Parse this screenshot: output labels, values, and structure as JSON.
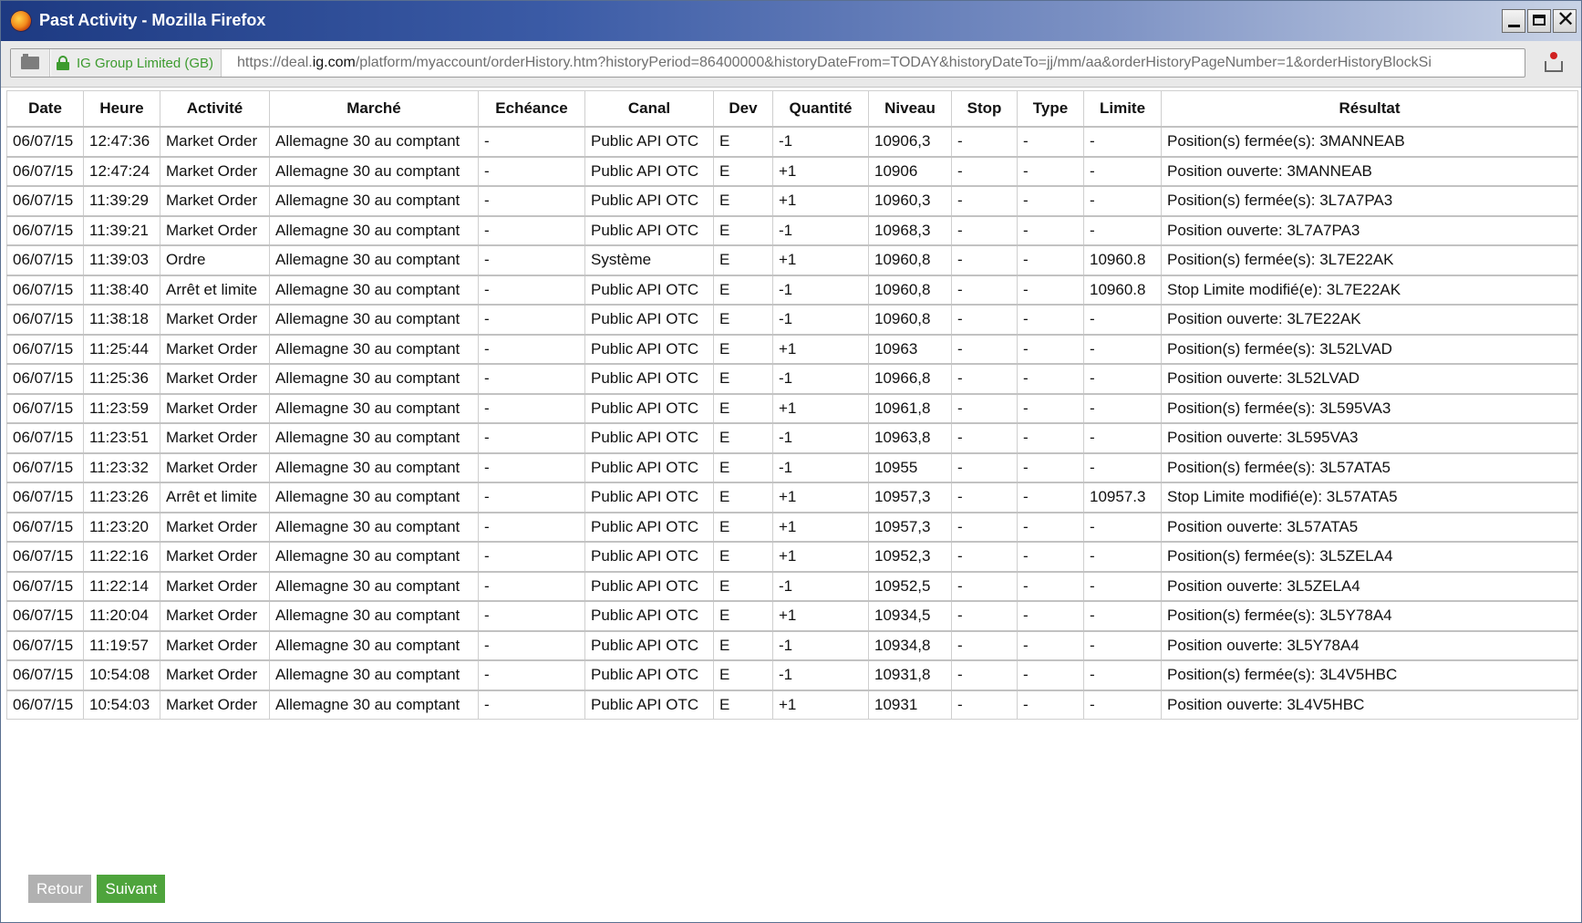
{
  "window": {
    "title": "Past Activity - Mozilla Firefox"
  },
  "urlbar": {
    "site_identity": "IG Group Limited (GB)",
    "url_prefix": "https://deal.",
    "url_domain": "ig.com",
    "url_path": "/platform/myaccount/orderHistory.htm?historyPeriod=86400000&historyDateFrom=TODAY&historyDateTo=jj/mm/aa&orderHistoryPageNumber=1&orderHistoryBlockSi"
  },
  "table": {
    "headers": [
      "Date",
      "Heure",
      "Activité",
      "Marché",
      "Echéance",
      "Canal",
      "Dev",
      "Quantité",
      "Niveau",
      "Stop",
      "Type",
      "Limite",
      "Résultat"
    ],
    "rows": [
      [
        "06/07/15",
        "12:47:36",
        "Market Order",
        "Allemagne 30 au comptant",
        "-",
        "Public API OTC",
        "E",
        "-1",
        "10906,3",
        "-",
        "-",
        "-",
        "Position(s) fermée(s): 3MANNEAB"
      ],
      [
        "06/07/15",
        "12:47:24",
        "Market Order",
        "Allemagne 30 au comptant",
        "-",
        "Public API OTC",
        "E",
        "+1",
        "10906",
        "-",
        "-",
        "-",
        "Position ouverte: 3MANNEAB"
      ],
      [
        "06/07/15",
        "11:39:29",
        "Market Order",
        "Allemagne 30 au comptant",
        "-",
        "Public API OTC",
        "E",
        "+1",
        "10960,3",
        "-",
        "-",
        "-",
        "Position(s) fermée(s): 3L7A7PA3"
      ],
      [
        "06/07/15",
        "11:39:21",
        "Market Order",
        "Allemagne 30 au comptant",
        "-",
        "Public API OTC",
        "E",
        "-1",
        "10968,3",
        "-",
        "-",
        "-",
        "Position ouverte: 3L7A7PA3"
      ],
      [
        "06/07/15",
        "11:39:03",
        "Ordre",
        "Allemagne 30 au comptant",
        "-",
        "Système",
        "E",
        "+1",
        "10960,8",
        "-",
        "-",
        "10960.8",
        "Position(s) fermée(s): 3L7E22AK"
      ],
      [
        "06/07/15",
        "11:38:40",
        "Arrêt et limite",
        "Allemagne 30 au comptant",
        "-",
        "Public API OTC",
        "E",
        "-1",
        "10960,8",
        "-",
        "-",
        "10960.8",
        "Stop Limite modifié(e): 3L7E22AK"
      ],
      [
        "06/07/15",
        "11:38:18",
        "Market Order",
        "Allemagne 30 au comptant",
        "-",
        "Public API OTC",
        "E",
        "-1",
        "10960,8",
        "-",
        "-",
        "-",
        "Position ouverte: 3L7E22AK"
      ],
      [
        "06/07/15",
        "11:25:44",
        "Market Order",
        "Allemagne 30 au comptant",
        "-",
        "Public API OTC",
        "E",
        "+1",
        "10963",
        "-",
        "-",
        "-",
        "Position(s) fermée(s): 3L52LVAD"
      ],
      [
        "06/07/15",
        "11:25:36",
        "Market Order",
        "Allemagne 30 au comptant",
        "-",
        "Public API OTC",
        "E",
        "-1",
        "10966,8",
        "-",
        "-",
        "-",
        "Position ouverte: 3L52LVAD"
      ],
      [
        "06/07/15",
        "11:23:59",
        "Market Order",
        "Allemagne 30 au comptant",
        "-",
        "Public API OTC",
        "E",
        "+1",
        "10961,8",
        "-",
        "-",
        "-",
        "Position(s) fermée(s): 3L595VA3"
      ],
      [
        "06/07/15",
        "11:23:51",
        "Market Order",
        "Allemagne 30 au comptant",
        "-",
        "Public API OTC",
        "E",
        "-1",
        "10963,8",
        "-",
        "-",
        "-",
        "Position ouverte: 3L595VA3"
      ],
      [
        "06/07/15",
        "11:23:32",
        "Market Order",
        "Allemagne 30 au comptant",
        "-",
        "Public API OTC",
        "E",
        "-1",
        "10955",
        "-",
        "-",
        "-",
        "Position(s) fermée(s): 3L57ATA5"
      ],
      [
        "06/07/15",
        "11:23:26",
        "Arrêt et limite",
        "Allemagne 30 au comptant",
        "-",
        "Public API OTC",
        "E",
        "+1",
        "10957,3",
        "-",
        "-",
        "10957.3",
        "Stop Limite modifié(e): 3L57ATA5"
      ],
      [
        "06/07/15",
        "11:23:20",
        "Market Order",
        "Allemagne 30 au comptant",
        "-",
        "Public API OTC",
        "E",
        "+1",
        "10957,3",
        "-",
        "-",
        "-",
        "Position ouverte: 3L57ATA5"
      ],
      [
        "06/07/15",
        "11:22:16",
        "Market Order",
        "Allemagne 30 au comptant",
        "-",
        "Public API OTC",
        "E",
        "+1",
        "10952,3",
        "-",
        "-",
        "-",
        "Position(s) fermée(s): 3L5ZELA4"
      ],
      [
        "06/07/15",
        "11:22:14",
        "Market Order",
        "Allemagne 30 au comptant",
        "-",
        "Public API OTC",
        "E",
        "-1",
        "10952,5",
        "-",
        "-",
        "-",
        "Position ouverte: 3L5ZELA4"
      ],
      [
        "06/07/15",
        "11:20:04",
        "Market Order",
        "Allemagne 30 au comptant",
        "-",
        "Public API OTC",
        "E",
        "+1",
        "10934,5",
        "-",
        "-",
        "-",
        "Position(s) fermée(s): 3L5Y78A4"
      ],
      [
        "06/07/15",
        "11:19:57",
        "Market Order",
        "Allemagne 30 au comptant",
        "-",
        "Public API OTC",
        "E",
        "-1",
        "10934,8",
        "-",
        "-",
        "-",
        "Position ouverte: 3L5Y78A4"
      ],
      [
        "06/07/15",
        "10:54:08",
        "Market Order",
        "Allemagne 30 au comptant",
        "-",
        "Public API OTC",
        "E",
        "-1",
        "10931,8",
        "-",
        "-",
        "-",
        "Position(s) fermée(s): 3L4V5HBC"
      ],
      [
        "06/07/15",
        "10:54:03",
        "Market Order",
        "Allemagne 30 au comptant",
        "-",
        "Public API OTC",
        "E",
        "+1",
        "10931",
        "-",
        "-",
        "-",
        "Position ouverte: 3L4V5HBC"
      ]
    ]
  },
  "pager": {
    "back_label": "Retour",
    "next_label": "Suivant"
  }
}
